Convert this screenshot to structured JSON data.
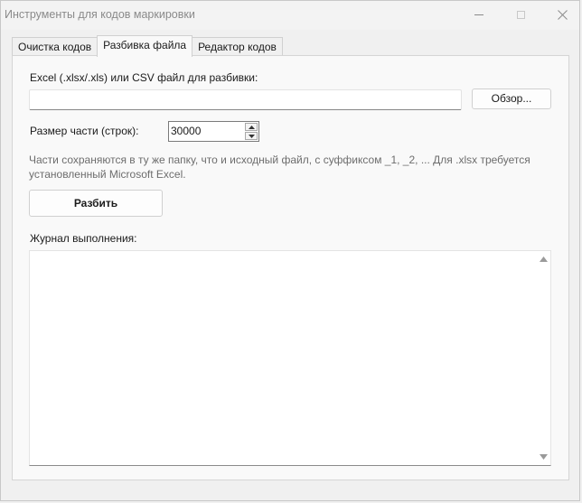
{
  "window": {
    "title": "Инструменты для кодов маркировки"
  },
  "tabs": [
    {
      "label": "Очистка кодов",
      "active": false
    },
    {
      "label": "Разбивка файла",
      "active": true
    },
    {
      "label": "Редактор кодов",
      "active": false
    }
  ],
  "split_tab": {
    "file_label": "Excel (.xlsx/.xls) или CSV файл для разбивки:",
    "file_value": "",
    "browse_label": "Обзор...",
    "size_label": "Размер части (строк):",
    "size_value": "30000",
    "hint": "Части сохраняются в ту же папку, что и исходный файл, с суффиксом _1, _2, ... Для .xlsx требуется установленный Microsoft Excel.",
    "split_button": "Разбить",
    "log_label": "Журнал выполнения:",
    "log_text": ""
  },
  "icons": {
    "minimize": "minimize-icon",
    "maximize": "maximize-icon",
    "close": "close-icon",
    "spin_up": "triangle-up-icon",
    "spin_down": "triangle-down-icon",
    "scroll_up": "scroll-up-icon",
    "scroll_down": "scroll-down-icon"
  }
}
